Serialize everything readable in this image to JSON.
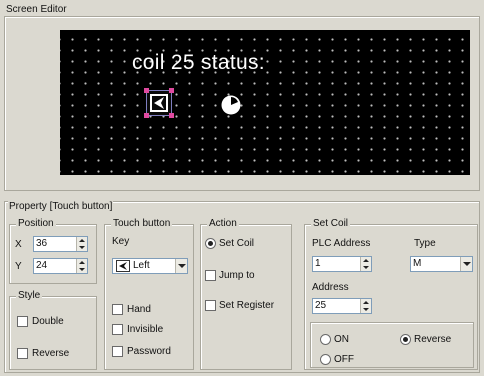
{
  "screen_editor": {
    "title": "Screen Editor",
    "lcd_text": "coil 25 status:"
  },
  "property": {
    "title": "Property  [Touch button]",
    "position": {
      "legend": "Position",
      "x_label": "X",
      "x_value": "36",
      "y_label": "Y",
      "y_value": "24"
    },
    "style": {
      "legend": "Style",
      "double_label": "Double",
      "reverse_label": "Reverse"
    },
    "touch_button": {
      "legend": "Touch button",
      "key_label": "Key",
      "key_value": "Left",
      "hand_label": "Hand",
      "invisible_label": "Invisible",
      "password_label": "Password"
    },
    "action": {
      "legend": "Action",
      "set_coil_label": "Set Coil",
      "jump_to_label": "Jump to",
      "set_register_label": "Set Register",
      "selected": "set_coil"
    },
    "set_coil": {
      "legend": "Set Coil",
      "plc_address_label": "PLC Address",
      "plc_address_value": "1",
      "type_label": "Type",
      "type_value": "M",
      "address_label": "Address",
      "address_value": "25",
      "on_label": "ON",
      "off_label": "OFF",
      "reverse_label": "Reverse",
      "selected": "reverse"
    }
  }
}
